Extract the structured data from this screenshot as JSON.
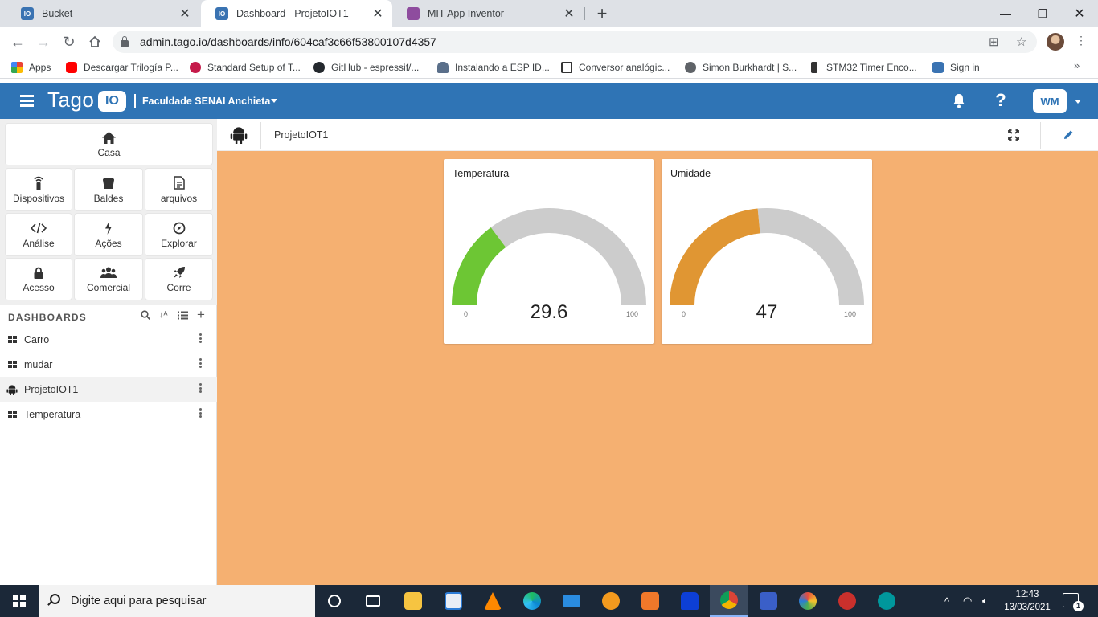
{
  "browser": {
    "tabs": [
      {
        "title": "Bucket",
        "icon": "tago-icon",
        "active": false
      },
      {
        "title": "Dashboard - ProjetoIOT1",
        "icon": "tago-icon",
        "active": true
      },
      {
        "title": "MIT App Inventor",
        "icon": "appinventor-icon",
        "active": false
      }
    ],
    "url": "admin.tago.io/dashboards/info/604caf3c66f53800107d4357",
    "bookmarks": [
      {
        "label": "Apps",
        "icon": "apps-grid-icon"
      },
      {
        "label": "Descargar Trilogía P...",
        "icon": "youtube-icon"
      },
      {
        "label": "Standard Setup of T...",
        "icon": "raspberry-icon"
      },
      {
        "label": "GitHub - espressif/...",
        "icon": "github-icon"
      },
      {
        "label": "Instalando a ESP ID...",
        "icon": "car-icon"
      },
      {
        "label": "Conversor analógic...",
        "icon": "doc-icon"
      },
      {
        "label": "Simon Burkhardt | S...",
        "icon": "globe-icon"
      },
      {
        "label": "STM32 Timer Enco...",
        "icon": "chip-icon"
      },
      {
        "label": "Sign in",
        "icon": "tago-icon"
      }
    ]
  },
  "tago": {
    "logo_text": "Tago",
    "logo_badge": "IO",
    "account": "Faculdade SENAI Anchieta",
    "user_initials": "WM",
    "nav": [
      {
        "label": "Casa",
        "icon": "home-icon"
      },
      {
        "label": "Dispositivos",
        "icon": "devices-icon"
      },
      {
        "label": "Baldes",
        "icon": "bucket-icon"
      },
      {
        "label": "arquivos",
        "icon": "file-icon"
      },
      {
        "label": "Análise",
        "icon": "code-icon"
      },
      {
        "label": "Ações",
        "icon": "bolt-icon"
      },
      {
        "label": "Explorar",
        "icon": "compass-icon"
      },
      {
        "label": "Acesso",
        "icon": "lock-icon"
      },
      {
        "label": "Comercial",
        "icon": "users-icon"
      },
      {
        "label": "Corre",
        "icon": "rocket-icon"
      }
    ],
    "dashboards_heading": "DASHBOARDS",
    "dashboards": [
      {
        "label": "Carro",
        "icon": "grid-icon"
      },
      {
        "label": "mudar",
        "icon": "grid-icon"
      },
      {
        "label": "ProjetoIOT1",
        "icon": "android-icon",
        "selected": true
      },
      {
        "label": "Temperatura",
        "icon": "grid-icon"
      }
    ],
    "current_dashboard": "ProjetoIOT1",
    "widgets": [
      {
        "title": "Temperatura",
        "value": "29.6",
        "min": "0",
        "max": "100",
        "fraction": 0.296,
        "color": "#6dc634"
      },
      {
        "title": "Umidade",
        "value": "47",
        "min": "0",
        "max": "100",
        "fraction": 0.47,
        "color": "#e09633"
      }
    ]
  },
  "colors": {
    "header": "#2f74b5",
    "canvas": "#f5b071",
    "gauge_track": "#cccccc"
  },
  "taskbar": {
    "search_placeholder": "Digite aqui para pesquisar",
    "time": "12:43",
    "date": "13/03/2021",
    "notifications": "1"
  }
}
